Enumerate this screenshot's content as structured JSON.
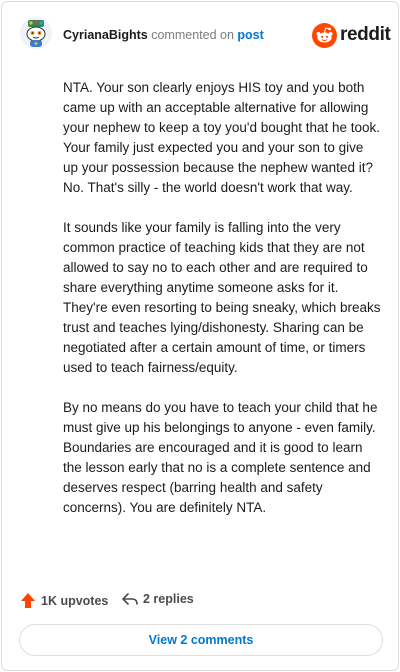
{
  "comment": {
    "username": "CyrianaBights",
    "action_text": "commented on",
    "post_link": "post",
    "avatar_icon": "snoo-avatar-icon",
    "brand": {
      "wordmark": "reddit",
      "icon": "reddit-logo-icon",
      "color": "#ff4500"
    },
    "paragraphs": [
      "NTA. Your son clearly enjoys HIS toy and you both came up with an acceptable alternative for allowing your nephew to keep a toy you'd bought that he took. Your family just expected you and your son to give up your possession because the nephew wanted it? No. That's silly - the world doesn't work that way.",
      "It sounds like your family is falling into the very common practice of teaching kids that they are not allowed to say no to each other and are required to share everything anytime someone asks for it. They're even resorting to being sneaky, which breaks trust and teaches lying/dishonesty. Sharing can be negotiated after a certain amount of time, or timers used to teach fairness/equity.",
      "By no means do you have to teach your child that he must give up his belongings to anyone - even family. Boundaries are encouraged and it is good to learn the lesson early that no is a complete sentence and deserves respect (barring health and safety concerns). You are definitely NTA."
    ],
    "upvotes": "1K upvotes",
    "upvote_icon": "upvote-arrow-icon",
    "upvote_color": "#ff4500",
    "replies": "2 replies",
    "reply_icon": "reply-arrow-icon",
    "view_comments": "View 2 comments",
    "link_color": "#0079d3"
  }
}
